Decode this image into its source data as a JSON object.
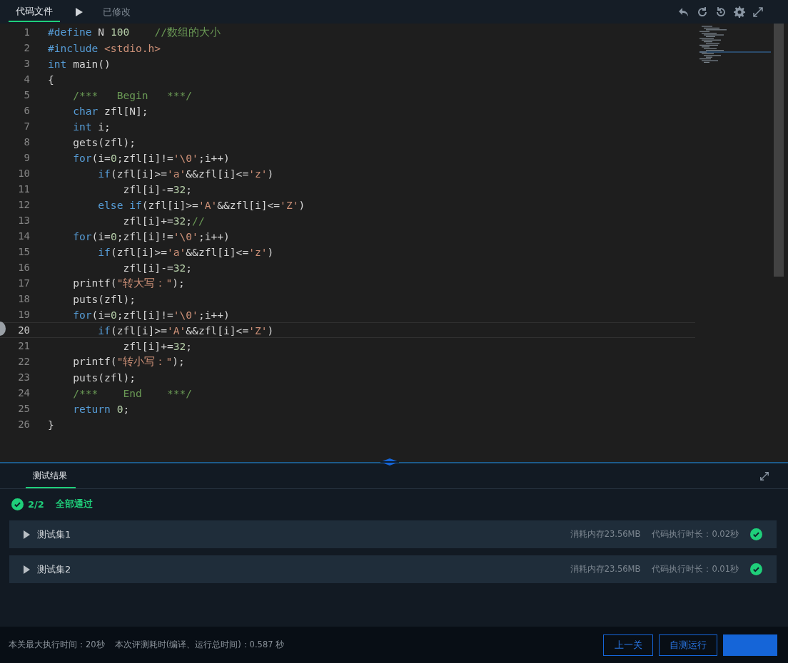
{
  "editor_tabs": [
    {
      "label": "代码文件",
      "selected": true
    }
  ],
  "file_status": "已修改",
  "code_lines": [
    {
      "number": "1",
      "current": false,
      "tokens": [
        {
          "kind": "kw",
          "text": "#define"
        },
        {
          "kind": "txt",
          "text": " N "
        },
        {
          "kind": "num",
          "text": "100"
        },
        {
          "kind": "cm",
          "text": "    //数组的大小"
        }
      ]
    },
    {
      "number": "2",
      "current": false,
      "tokens": [
        {
          "kind": "kw",
          "text": "#include"
        },
        {
          "kind": "str",
          "text": " <stdio.h>"
        }
      ]
    },
    {
      "number": "3",
      "current": false,
      "tokens": [
        {
          "kind": "kw",
          "text": "int"
        },
        {
          "kind": "txt",
          "text": " main()"
        }
      ]
    },
    {
      "number": "4",
      "current": false,
      "tokens": [
        {
          "kind": "txt",
          "text": "{"
        }
      ]
    },
    {
      "number": "5",
      "current": false,
      "tokens": [
        {
          "kind": "cm",
          "text": "    /***   Begin   ***/"
        }
      ]
    },
    {
      "number": "6",
      "current": false,
      "tokens": [
        {
          "kind": "kw",
          "text": "    char"
        },
        {
          "kind": "txt",
          "text": " zfl[N];"
        }
      ]
    },
    {
      "number": "7",
      "current": false,
      "tokens": [
        {
          "kind": "kw",
          "text": "    int"
        },
        {
          "kind": "txt",
          "text": " i;"
        }
      ]
    },
    {
      "number": "8",
      "current": false,
      "tokens": [
        {
          "kind": "txt",
          "text": "    gets(zfl);"
        }
      ]
    },
    {
      "number": "9",
      "current": false,
      "tokens": [
        {
          "kind": "kw",
          "text": "    for"
        },
        {
          "kind": "txt",
          "text": "(i="
        },
        {
          "kind": "num",
          "text": "0"
        },
        {
          "kind": "txt",
          "text": ";zfl[i]!="
        },
        {
          "kind": "str",
          "text": "'\\0'"
        },
        {
          "kind": "txt",
          "text": ";i++)"
        }
      ]
    },
    {
      "number": "10",
      "current": false,
      "tokens": [
        {
          "kind": "kw",
          "text": "        if"
        },
        {
          "kind": "txt",
          "text": "(zfl[i]>="
        },
        {
          "kind": "str",
          "text": "'a'"
        },
        {
          "kind": "txt",
          "text": "&&zfl[i]<="
        },
        {
          "kind": "str",
          "text": "'z'"
        },
        {
          "kind": "txt",
          "text": ")"
        }
      ]
    },
    {
      "number": "11",
      "current": false,
      "tokens": [
        {
          "kind": "txt",
          "text": "            zfl[i]-="
        },
        {
          "kind": "num",
          "text": "32"
        },
        {
          "kind": "txt",
          "text": ";"
        }
      ]
    },
    {
      "number": "12",
      "current": false,
      "tokens": [
        {
          "kind": "kw",
          "text": "        else if"
        },
        {
          "kind": "txt",
          "text": "(zfl[i]>="
        },
        {
          "kind": "str",
          "text": "'A'"
        },
        {
          "kind": "txt",
          "text": "&&zfl[i]<="
        },
        {
          "kind": "str",
          "text": "'Z'"
        },
        {
          "kind": "txt",
          "text": ")"
        }
      ]
    },
    {
      "number": "13",
      "current": false,
      "tokens": [
        {
          "kind": "txt",
          "text": "            zfl[i]+="
        },
        {
          "kind": "num",
          "text": "32"
        },
        {
          "kind": "txt",
          "text": ";"
        },
        {
          "kind": "cm",
          "text": "//"
        }
      ]
    },
    {
      "number": "14",
      "current": false,
      "tokens": [
        {
          "kind": "kw",
          "text": "    for"
        },
        {
          "kind": "txt",
          "text": "(i="
        },
        {
          "kind": "num",
          "text": "0"
        },
        {
          "kind": "txt",
          "text": ";zfl[i]!="
        },
        {
          "kind": "str",
          "text": "'\\0'"
        },
        {
          "kind": "txt",
          "text": ";i++)"
        }
      ]
    },
    {
      "number": "15",
      "current": false,
      "tokens": [
        {
          "kind": "kw",
          "text": "        if"
        },
        {
          "kind": "txt",
          "text": "(zfl[i]>="
        },
        {
          "kind": "str",
          "text": "'a'"
        },
        {
          "kind": "txt",
          "text": "&&zfl[i]<="
        },
        {
          "kind": "str",
          "text": "'z'"
        },
        {
          "kind": "txt",
          "text": ")"
        }
      ]
    },
    {
      "number": "16",
      "current": false,
      "tokens": [
        {
          "kind": "txt",
          "text": "            zfl[i]-="
        },
        {
          "kind": "num",
          "text": "32"
        },
        {
          "kind": "txt",
          "text": ";"
        }
      ]
    },
    {
      "number": "17",
      "current": false,
      "tokens": [
        {
          "kind": "txt",
          "text": "    printf("
        },
        {
          "kind": "str",
          "text": "\"转大写：\""
        },
        {
          "kind": "txt",
          "text": ");"
        }
      ]
    },
    {
      "number": "18",
      "current": false,
      "tokens": [
        {
          "kind": "txt",
          "text": "    puts(zfl);"
        }
      ]
    },
    {
      "number": "19",
      "current": false,
      "tokens": [
        {
          "kind": "kw",
          "text": "    for"
        },
        {
          "kind": "txt",
          "text": "(i="
        },
        {
          "kind": "num",
          "text": "0"
        },
        {
          "kind": "txt",
          "text": ";zfl[i]!="
        },
        {
          "kind": "str",
          "text": "'\\0'"
        },
        {
          "kind": "txt",
          "text": ";i++)"
        }
      ]
    },
    {
      "number": "20",
      "current": true,
      "tokens": [
        {
          "kind": "kw",
          "text": "        if"
        },
        {
          "kind": "txt",
          "text": "(zfl[i]>="
        },
        {
          "kind": "str",
          "text": "'A'"
        },
        {
          "kind": "txt",
          "text": "&&zfl[i]<="
        },
        {
          "kind": "str",
          "text": "'Z'"
        },
        {
          "kind": "txt",
          "text": ")"
        }
      ]
    },
    {
      "number": "21",
      "current": false,
      "tokens": [
        {
          "kind": "txt",
          "text": "            zfl[i]+="
        },
        {
          "kind": "num",
          "text": "32"
        },
        {
          "kind": "txt",
          "text": ";"
        }
      ]
    },
    {
      "number": "22",
      "current": false,
      "tokens": [
        {
          "kind": "txt",
          "text": "    printf("
        },
        {
          "kind": "str",
          "text": "\"转小写：\""
        },
        {
          "kind": "txt",
          "text": ");"
        }
      ]
    },
    {
      "number": "23",
      "current": false,
      "tokens": [
        {
          "kind": "txt",
          "text": "    puts(zfl);"
        }
      ]
    },
    {
      "number": "24",
      "current": false,
      "tokens": [
        {
          "kind": "cm",
          "text": "    /***    End    ***/"
        }
      ]
    },
    {
      "number": "25",
      "current": false,
      "tokens": [
        {
          "kind": "kw",
          "text": "    return "
        },
        {
          "kind": "num",
          "text": "0"
        },
        {
          "kind": "txt",
          "text": ";"
        }
      ]
    },
    {
      "number": "26",
      "current": false,
      "tokens": [
        {
          "kind": "txt",
          "text": "}"
        }
      ]
    }
  ],
  "result_tabs": [
    {
      "label": "测试结果",
      "selected": true
    }
  ],
  "summary": {
    "passed": true,
    "count": "2/2",
    "text": "全部通过"
  },
  "test_sets": [
    {
      "name": "测试集1",
      "expanded": false,
      "memory": "消耗内存23.56MB",
      "time": "代码执行时长：0.02秒",
      "passed": true
    },
    {
      "name": "测试集2",
      "expanded": false,
      "memory": "消耗内存23.56MB",
      "time": "代码执行时长：0.01秒",
      "passed": true
    }
  ],
  "footer": {
    "max_time": "本关最大执行时间：20秒",
    "eval_time": "本次评测耗时(编译、运行总时间)：0.587 秒"
  },
  "buttons": [
    {
      "kind": "outline",
      "label": "上一关"
    },
    {
      "kind": "outline",
      "label": "自测运行"
    },
    {
      "kind": "filled"
    }
  ]
}
